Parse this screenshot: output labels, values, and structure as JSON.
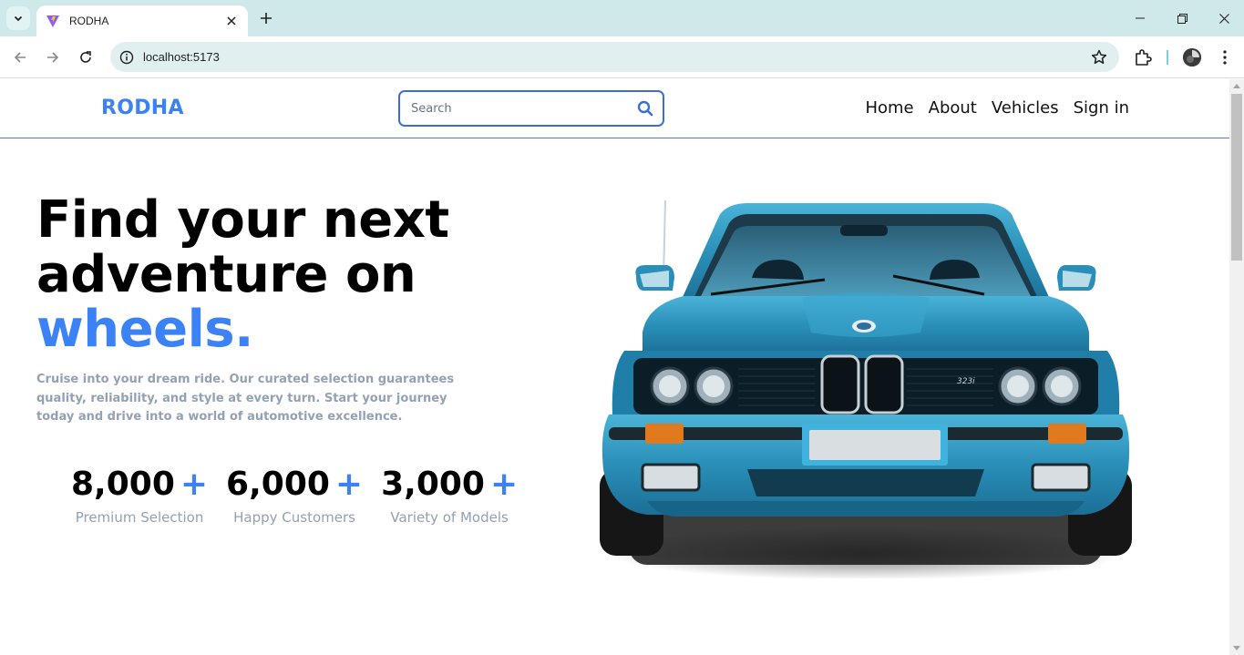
{
  "browser": {
    "tab_title": "RODHA",
    "url": "localhost:5173"
  },
  "site": {
    "logo": "RODHA",
    "search_placeholder": "Search",
    "nav": [
      "Home",
      "About",
      "Vehicles",
      "Sign in"
    ]
  },
  "hero": {
    "title_line1": "Find your next",
    "title_line2": "adventure on",
    "title_accent": "wheels.",
    "description": "Cruise into your dream ride. Our curated selection guarantees quality, reliability, and style at every turn. Start your journey today and drive into a world of automotive excellence.",
    "stats": [
      {
        "value": "8,000",
        "suffix": "+",
        "label": "Premium Selection"
      },
      {
        "value": "6,000",
        "suffix": "+",
        "label": "Happy Customers"
      },
      {
        "value": "3,000",
        "suffix": "+",
        "label": "Variety of Models"
      }
    ]
  },
  "colors": {
    "accent": "#3b82f6",
    "muted_text": "#94a0b4",
    "car_body": "#2a8fb8"
  }
}
